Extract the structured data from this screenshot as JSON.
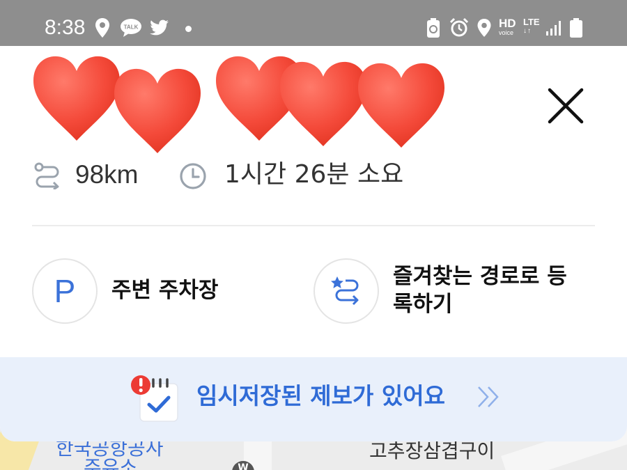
{
  "status_bar": {
    "time": "8:38",
    "left_icons": [
      "location-pin-icon",
      "kakaotalk-icon",
      "twitter-icon"
    ],
    "kakao_label": "TALK",
    "right_icons": [
      "battery-saver-icon",
      "alarm-icon",
      "location-icon",
      "hd-voice-icon",
      "lte-icon",
      "signal-icon",
      "battery-icon"
    ],
    "hd_label": "HD",
    "voice_label": "voice",
    "lte_label": "LTE",
    "lte_arrows": "↓↑"
  },
  "route_card": {
    "distance": "98km",
    "duration": "1시간 26분 소요",
    "close_icon": "close-icon",
    "route_icon": "route-icon",
    "clock_icon": "clock-icon"
  },
  "actions": {
    "parking": {
      "icon_letter": "P",
      "label": "주변 주차장"
    },
    "favorite": {
      "label": "즐겨찾는 경로로 등록하기",
      "icon": "favorite-route-icon"
    }
  },
  "notice": {
    "text": "임시저장된 제보가 있어요",
    "icon": "calendar-check-alert-icon",
    "chevron_icon": "double-chevron-right-icon"
  },
  "map": {
    "labels": [
      "한국공항공사",
      "주유소",
      "고추장삼겹구이"
    ]
  },
  "colors": {
    "accent": "#3b72d9",
    "status_bar": "#8e8e8e",
    "notice_bg": "#e9f0fb",
    "heart": "#f44a3a"
  }
}
